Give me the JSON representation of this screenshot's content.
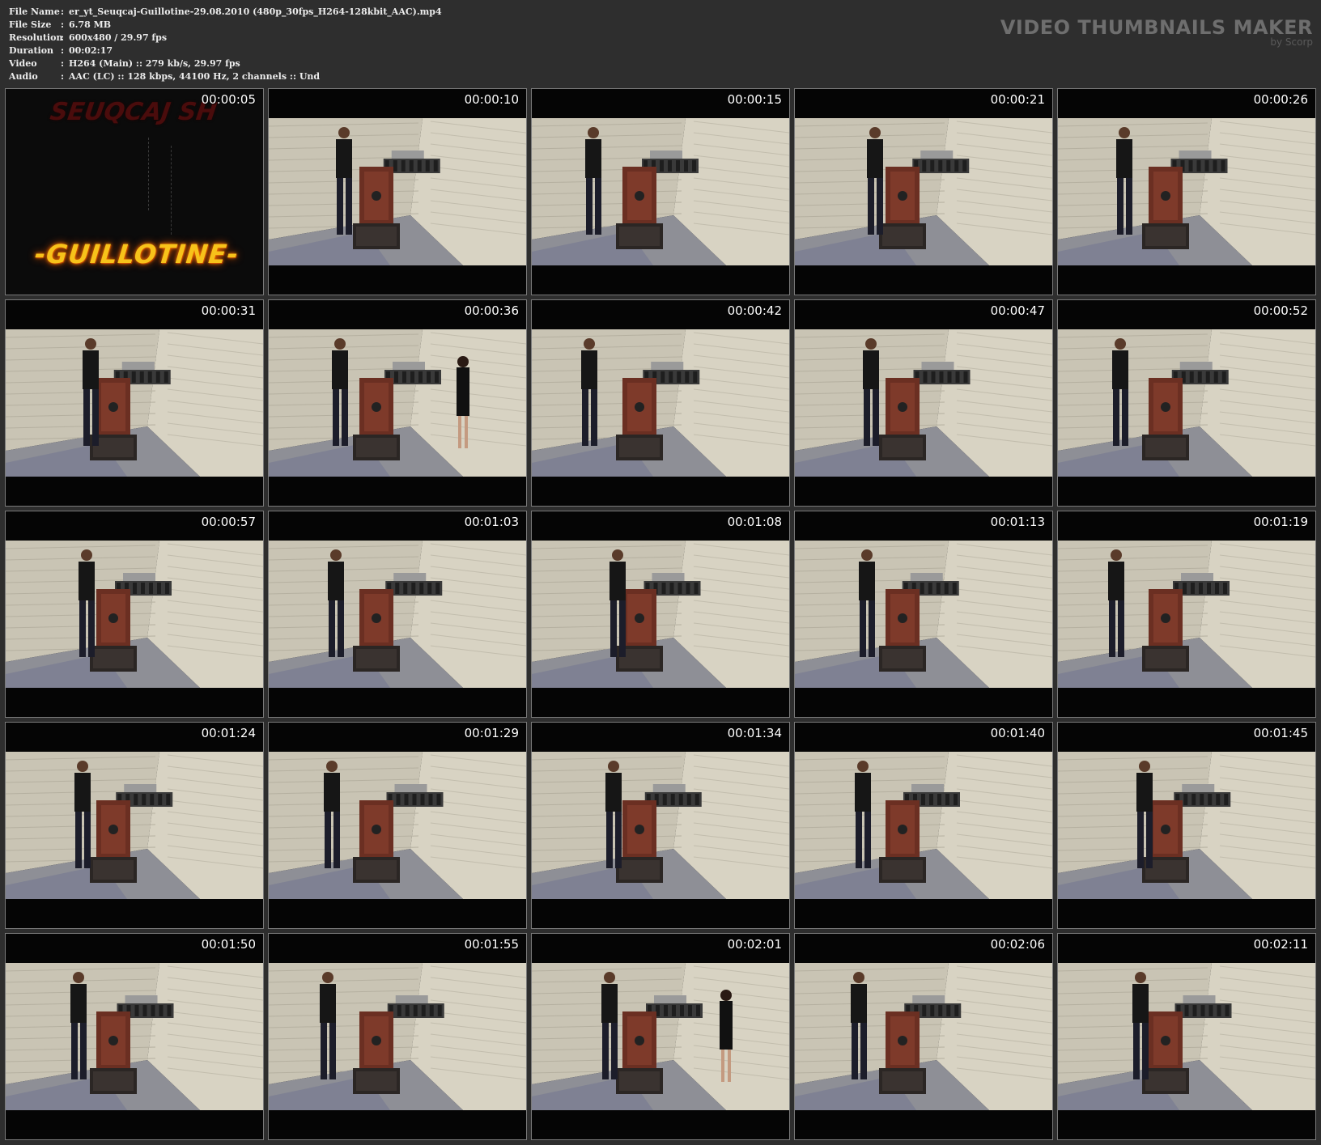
{
  "file_info": [
    {
      "label": "File Name",
      "value": "er_yt_Seuqcaj-Guillotine-29.08.2010 (480p_30fps_H264-128kbit_AAC).mp4"
    },
    {
      "label": "File Size",
      "value": "6.78 MB"
    },
    {
      "label": "Resolution",
      "value": "600x480 / 29.97 fps"
    },
    {
      "label": "Duration",
      "value": "00:02:17"
    },
    {
      "label": "Video",
      "value": "H264 (Main) :: 279 kb/s, 29.97 fps"
    },
    {
      "label": "Audio",
      "value": "AAC (LC) :: 128 kbps, 44100 Hz, 2 channels :: Und"
    }
  ],
  "brand": {
    "title": "VIDEO THUMBNAILS MAKER",
    "subtitle": "by Scorp"
  },
  "title_card": {
    "top_text": "SEUQCAJ SH",
    "main_text": "-GUILLOTINE-"
  },
  "thumbnails": [
    {
      "time": "00:00:05",
      "kind": "title"
    },
    {
      "time": "00:00:10",
      "kind": "scene"
    },
    {
      "time": "00:00:15",
      "kind": "scene"
    },
    {
      "time": "00:00:21",
      "kind": "scene"
    },
    {
      "time": "00:00:26",
      "kind": "scene"
    },
    {
      "time": "00:00:31",
      "kind": "scene"
    },
    {
      "time": "00:00:36",
      "kind": "scene"
    },
    {
      "time": "00:00:42",
      "kind": "scene"
    },
    {
      "time": "00:00:47",
      "kind": "scene"
    },
    {
      "time": "00:00:52",
      "kind": "scene"
    },
    {
      "time": "00:00:57",
      "kind": "scene"
    },
    {
      "time": "00:01:03",
      "kind": "scene"
    },
    {
      "time": "00:01:08",
      "kind": "scene"
    },
    {
      "time": "00:01:13",
      "kind": "scene"
    },
    {
      "time": "00:01:19",
      "kind": "scene"
    },
    {
      "time": "00:01:24",
      "kind": "scene"
    },
    {
      "time": "00:01:29",
      "kind": "scene"
    },
    {
      "time": "00:01:34",
      "kind": "scene"
    },
    {
      "time": "00:01:40",
      "kind": "scene"
    },
    {
      "time": "00:01:45",
      "kind": "scene"
    },
    {
      "time": "00:01:50",
      "kind": "scene"
    },
    {
      "time": "00:01:55",
      "kind": "scene"
    },
    {
      "time": "00:02:01",
      "kind": "scene"
    },
    {
      "time": "00:02:06",
      "kind": "scene"
    },
    {
      "time": "00:02:11",
      "kind": "scene"
    }
  ],
  "colors": {
    "background": "#2e2e2e",
    "thumb_border": "#7a7a7a",
    "wall": "#cfc9b8",
    "floor": "#8e8f96",
    "wood": "#6b2f22",
    "title_glow": "#f7c21a"
  }
}
